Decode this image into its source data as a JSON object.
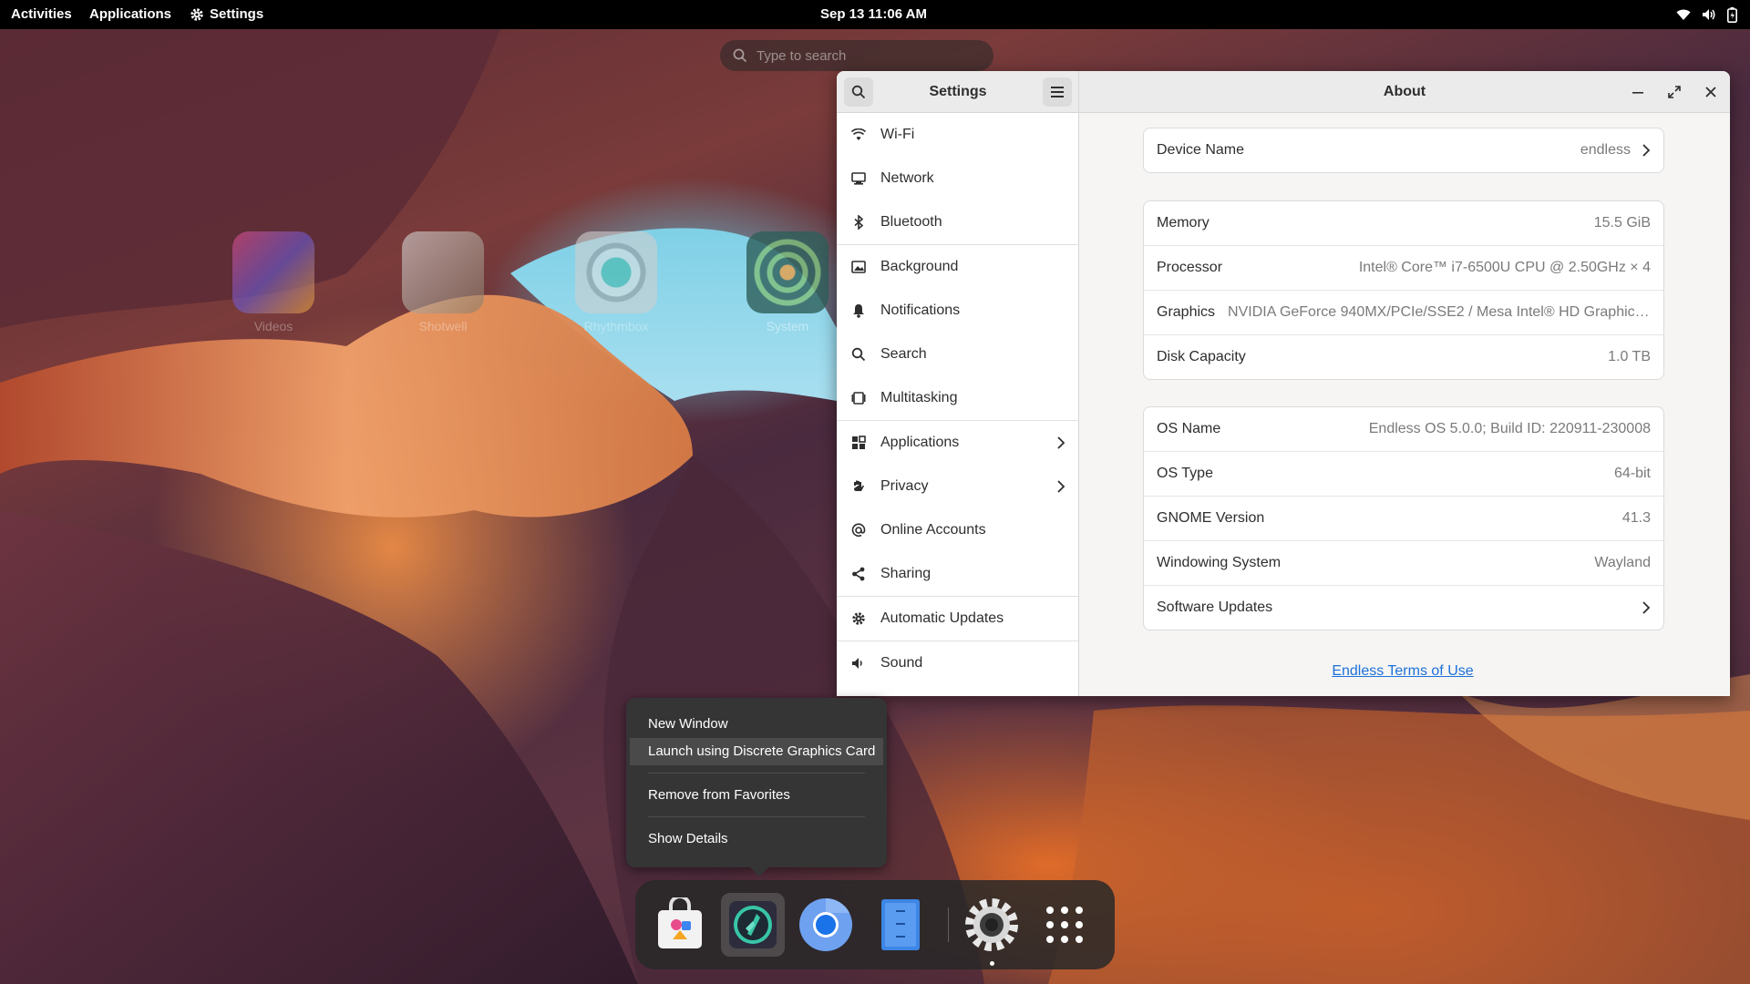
{
  "topbar": {
    "activities": "Activities",
    "applications": "Applications",
    "focused_app": "Settings",
    "clock": "Sep 13  11:06 AM"
  },
  "overview": {
    "search_placeholder": "Type to search",
    "app_icons": [
      {
        "label": "Videos",
        "icon": "videos-icon"
      },
      {
        "label": "Shotwell",
        "icon": "shotwell-icon"
      },
      {
        "label": "Rhythmbox",
        "icon": "rhythmbox-icon"
      },
      {
        "label": "System",
        "icon": "system-icon"
      }
    ]
  },
  "settings_window": {
    "sidebar_title": "Settings",
    "page_title": "About",
    "sidebar": [
      {
        "label": "Wi-Fi",
        "icon": "wifi-icon"
      },
      {
        "label": "Network",
        "icon": "network-icon"
      },
      {
        "label": "Bluetooth",
        "icon": "bluetooth-icon"
      },
      {
        "label": "Background",
        "icon": "background-icon"
      },
      {
        "label": "Notifications",
        "icon": "bell-icon"
      },
      {
        "label": "Search",
        "icon": "search-icon"
      },
      {
        "label": "Multitasking",
        "icon": "multitasking-icon"
      },
      {
        "label": "Applications",
        "icon": "apps-grid-icon",
        "has_submenu": true
      },
      {
        "label": "Privacy",
        "icon": "hand-icon",
        "has_submenu": true
      },
      {
        "label": "Online Accounts",
        "icon": "at-icon"
      },
      {
        "label": "Sharing",
        "icon": "share-icon"
      },
      {
        "label": "Automatic Updates",
        "icon": "gear-icon"
      },
      {
        "label": "Sound",
        "icon": "speaker-icon"
      }
    ],
    "device": {
      "label": "Device Name",
      "value": "endless"
    },
    "hardware": [
      {
        "label": "Memory",
        "value": "15.5 GiB"
      },
      {
        "label": "Processor",
        "value": "Intel® Core™ i7-6500U CPU @ 2.50GHz × 4"
      },
      {
        "label": "Graphics",
        "value": "NVIDIA GeForce 940MX/PCIe/SSE2 / Mesa Intel® HD Graphics ..."
      },
      {
        "label": "Disk Capacity",
        "value": "1.0 TB"
      }
    ],
    "software": [
      {
        "label": "OS Name",
        "value": "Endless OS 5.0.0; Build ID: 220911-230008"
      },
      {
        "label": "OS Type",
        "value": "64-bit"
      },
      {
        "label": "GNOME Version",
        "value": "41.3"
      },
      {
        "label": "Windowing System",
        "value": "Wayland"
      },
      {
        "label": "Software Updates",
        "value": ""
      }
    ],
    "terms_link": "Endless Terms of Use"
  },
  "context_menu": {
    "items": [
      "New Window",
      "Launch using Discrete Graphics Card",
      "Remove from Favorites",
      "Show Details"
    ],
    "highlighted_index": 1
  },
  "dock": {
    "items": [
      "app-center-icon",
      "app-launcher-icon",
      "chromium-icon",
      "files-icon",
      "settings-gear-icon",
      "show-apps-icon"
    ],
    "active_index": 1
  },
  "colors": {
    "accent": "#1c71d8",
    "topbar": "#000000",
    "menu_bg": "#353535"
  }
}
